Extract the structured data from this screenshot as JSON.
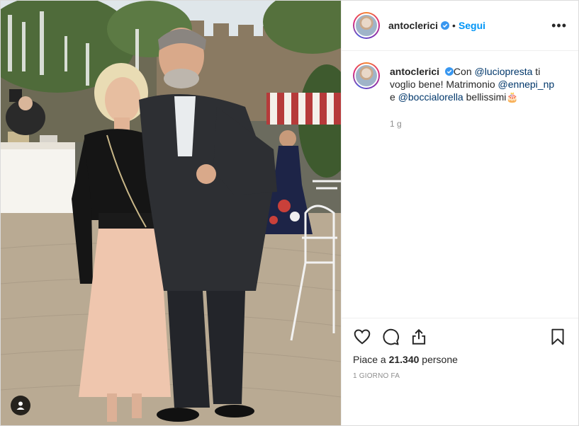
{
  "post": {
    "username": "antoclerici",
    "follow_label": "Segui",
    "separator": "•",
    "more_label": "•••",
    "caption": {
      "prefix": "Con ",
      "mention1": "@luciopresta",
      "part2": " ti voglio bene! Matrimonio ",
      "mention2": "@ennepi_np",
      "part3": " e ",
      "mention3": "@boccialorella",
      "part4": " bellissimi",
      "emoji": "🎂"
    },
    "caption_time": "1 g",
    "likes_prefix": "Piace a ",
    "likes_count": "21.340",
    "likes_suffix": " persone",
    "date": "1 GIORNO FA"
  },
  "icons": {
    "like": "heart-icon",
    "comment": "comment-icon",
    "share": "share-icon",
    "save": "bookmark-icon",
    "user_tag": "user-tag-icon",
    "verified": "verified-badge-icon"
  },
  "colors": {
    "follow": "#0095f6",
    "verified": "#3897f0",
    "mention": "#00376b",
    "secondary_text": "#8e8e8e"
  }
}
